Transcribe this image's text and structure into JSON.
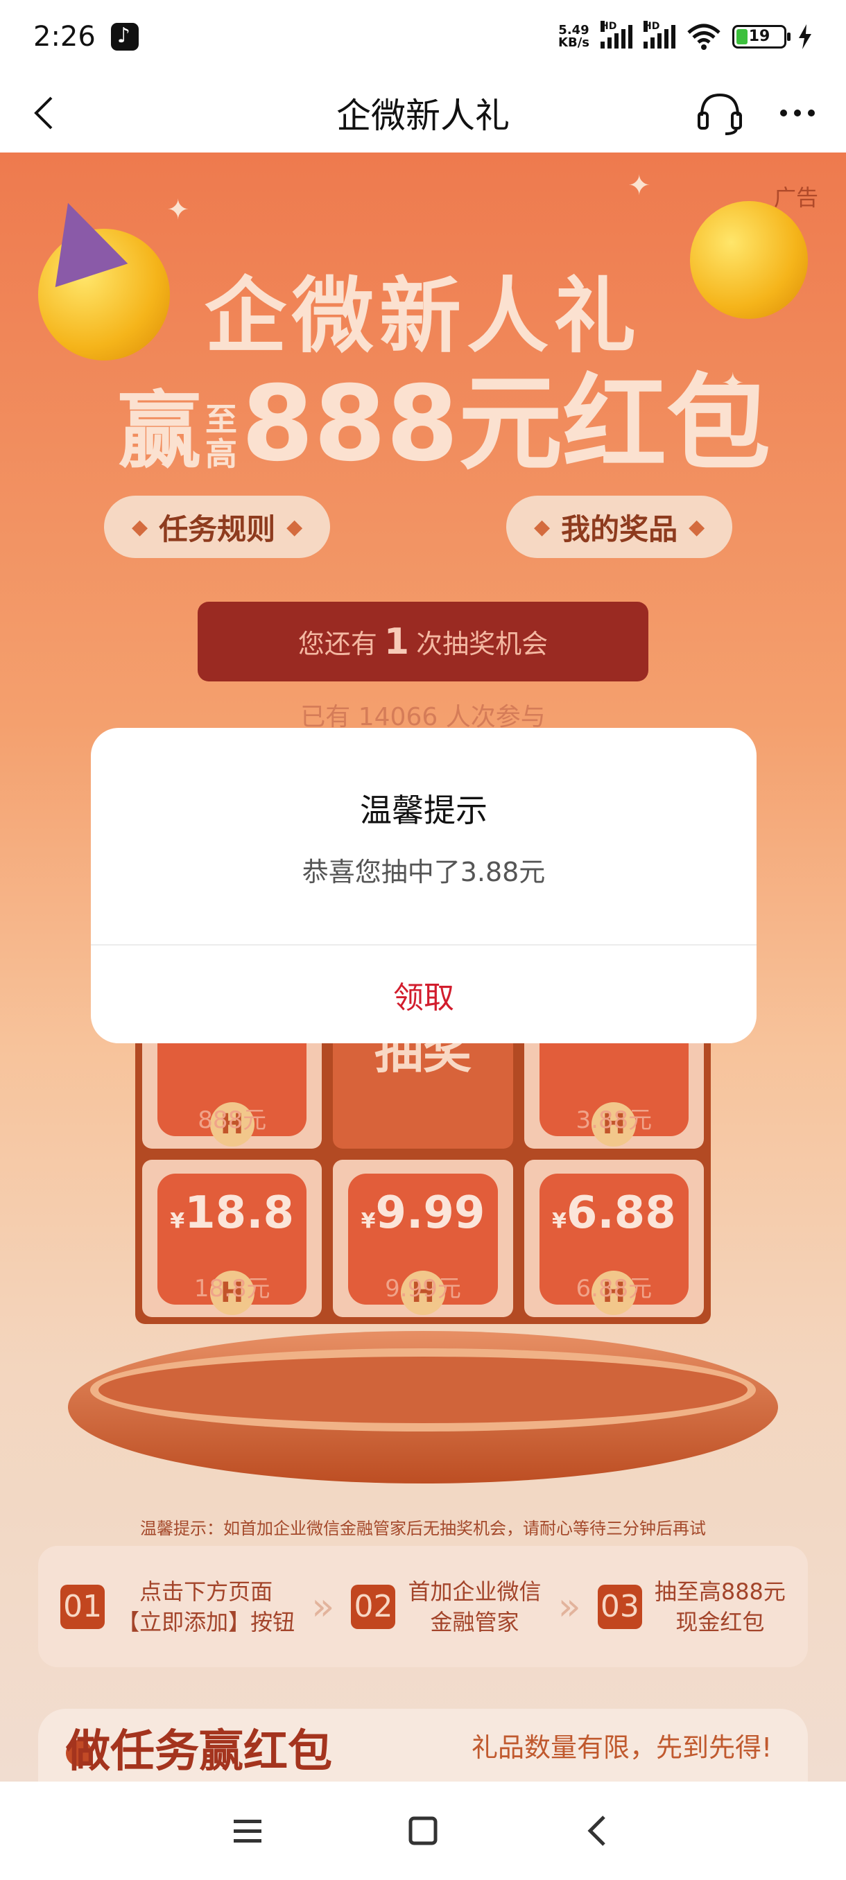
{
  "status_bar": {
    "time": "2:26",
    "speed_top": "5.49",
    "speed_bottom": "KB/s",
    "hd1": "HD",
    "hd2": "HD",
    "battery": "19"
  },
  "nav": {
    "title": "企微新人礼"
  },
  "page": {
    "ad_label": "广告",
    "hero_line1": "企微新人礼",
    "hero_line2_win": "赢",
    "hero_line2_up1": "至",
    "hero_line2_up2": "高",
    "hero_line2_amount": "888元红包",
    "rules_button": "任务规则",
    "prizes_button": "我的奖品",
    "chance_prefix": "您还有",
    "chance_count": "1",
    "chance_suffix": "次抽奖机会",
    "joined": "已有 14066 人次参与",
    "grid": [
      {
        "amount": "",
        "sub": "888元"
      },
      {
        "draw": "抽奖"
      },
      {
        "amount": "",
        "sub": "3.88元"
      },
      {
        "amount": "18.8",
        "sub": "18.8元"
      },
      {
        "amount": "9.99",
        "sub": "9.99元"
      },
      {
        "amount": "6.88",
        "sub": "6.88元"
      }
    ],
    "yen": "¥",
    "coin": "H",
    "tip": "温馨提示：如首加企业微信金融管家后无抽奖机会，请耐心等待三分钟后再试",
    "steps": [
      {
        "no": "01",
        "line1": "点击下方页面",
        "line2": "【立即添加】按钮"
      },
      {
        "no": "02",
        "line1": "首加企业微信",
        "line2": "金融管家"
      },
      {
        "no": "03",
        "line1": "抽至高888元",
        "line2": "现金红包"
      }
    ],
    "task_title": "做任务赢红包",
    "task_note": "礼品数量有限，先到先得!"
  },
  "dialog": {
    "title": "温馨提示",
    "message": "恭喜您抽中了3.88元",
    "button": "领取"
  },
  "colors": {
    "accent_red": "#d21d2d",
    "page_orange": "#ee7a4e"
  }
}
